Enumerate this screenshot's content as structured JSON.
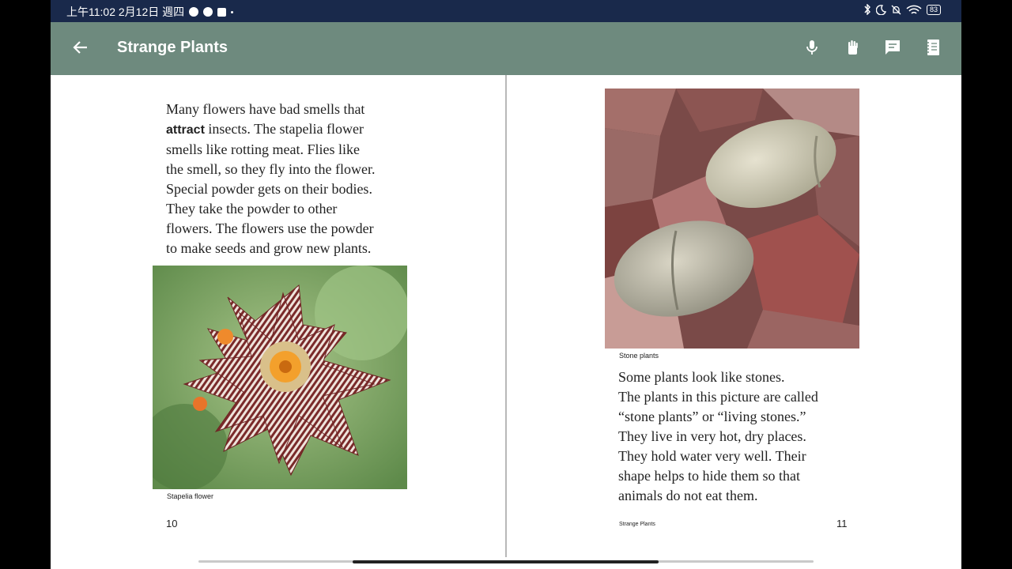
{
  "status_bar": {
    "time_date": "上午11:02 2月12日 週四",
    "battery": "83"
  },
  "app_bar": {
    "title": "Strange Plants",
    "icons": [
      "back-arrow-icon",
      "microphone-icon",
      "hand-icon",
      "comment-icon",
      "notebook-icon"
    ]
  },
  "left_page": {
    "paragraph": {
      "line1": "Many flowers have bad smells that",
      "line2_bold": "attract",
      "line2_rest": " insects. The stapelia flower",
      "line3": "smells like rotting meat. Flies like",
      "line4": "the smell, so they fly into the flower.",
      "line5": "Special powder gets on their bodies.",
      "line6": "They take the powder to other",
      "line7": "flowers. The flowers use the powder",
      "line8": "to make seeds and grow new plants."
    },
    "caption": "Stapelia flower",
    "page_number": "10"
  },
  "right_page": {
    "caption": "Stone plants",
    "paragraph": {
      "line1": "Some plants look like stones.",
      "line2": "The plants in this picture are called",
      "line3": "“stone plants” or “living stones.”",
      "line4": "They live in very hot, dry places.",
      "line5": "They hold water very well. Their",
      "line6": "shape helps to hide them so that",
      "line7": "animals do not eat them."
    },
    "footer_title": "Strange Plants",
    "page_number": "11"
  },
  "colors": {
    "status_bar": "#19294b",
    "app_bar": "#6e8a7e"
  }
}
